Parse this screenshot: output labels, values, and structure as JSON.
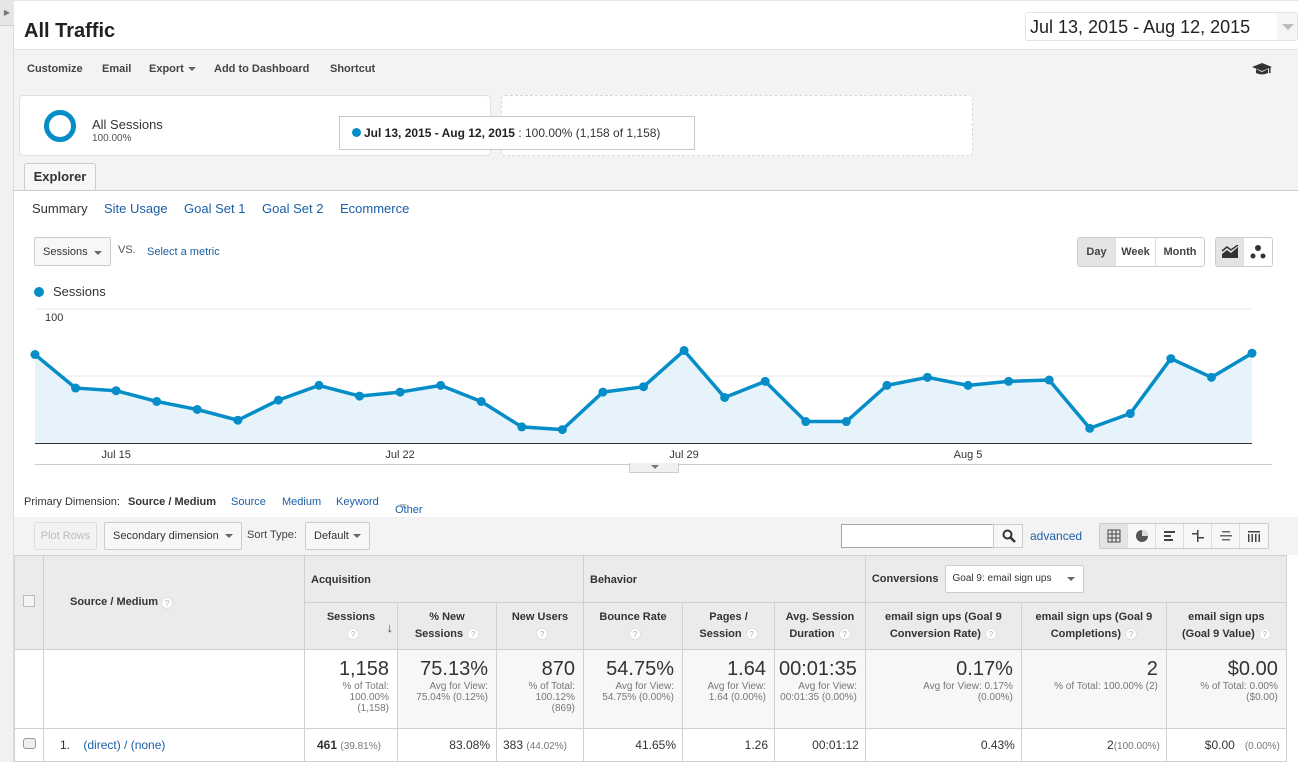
{
  "header": {
    "title": "All Traffic",
    "date_range": "Jul 13, 2015 - Aug 12, 2015"
  },
  "toolbar": {
    "customize": "Customize",
    "email": "Email",
    "export": "Export",
    "add_to_dashboard": "Add to Dashboard",
    "shortcut": "Shortcut",
    "help_icon": "graduation-cap-icon"
  },
  "segments": {
    "name": "All Sessions",
    "percent": "100.00%"
  },
  "tooltip": {
    "range": "Jul 13, 2015 - Aug 12, 2015",
    "value": " : 100.00% (1,158 of 1,158)"
  },
  "tabs": {
    "explorer": "Explorer",
    "subtabs": [
      "Summary",
      "Site Usage",
      "Goal Set 1",
      "Goal Set 2",
      "Ecommerce"
    ]
  },
  "chart_controls": {
    "metric": "Sessions",
    "vs": "VS.",
    "select_metric": "Select a metric",
    "granularity": [
      "Day",
      "Week",
      "Month"
    ],
    "granularity_selected": "Day"
  },
  "chart_data": {
    "type": "area",
    "title": "",
    "legend": [
      "Sessions"
    ],
    "legend_position": "top-left",
    "color": "#058dc7",
    "x": [
      "Jul 13",
      "Jul 14",
      "Jul 15",
      "Jul 16",
      "Jul 17",
      "Jul 18",
      "Jul 19",
      "Jul 20",
      "Jul 21",
      "Jul 22",
      "Jul 23",
      "Jul 24",
      "Jul 25",
      "Jul 26",
      "Jul 27",
      "Jul 28",
      "Jul 29",
      "Jul 30",
      "Jul 31",
      "Aug 1",
      "Aug 2",
      "Aug 3",
      "Aug 4",
      "Aug 5",
      "Aug 6",
      "Aug 7",
      "Aug 8",
      "Aug 9",
      "Aug 10",
      "Aug 11",
      "Aug 12"
    ],
    "series": [
      {
        "name": "Sessions",
        "values": [
          66,
          41,
          39,
          31,
          25,
          17,
          32,
          43,
          35,
          38,
          43,
          31,
          12,
          10,
          38,
          42,
          69,
          34,
          46,
          16,
          16,
          43,
          49,
          43,
          46,
          47,
          11,
          22,
          63,
          49,
          67
        ]
      }
    ],
    "xticks": [
      "Jul 15",
      "Jul 22",
      "Jul 29",
      "Aug 5"
    ],
    "yticks": [
      "100",
      "50"
    ],
    "ylim": [
      0,
      100
    ],
    "grid": true
  },
  "primary_dimension": {
    "label": "Primary Dimension:",
    "current": "Source / Medium",
    "options": [
      "Source",
      "Medium",
      "Keyword",
      "Other"
    ]
  },
  "table_tools": {
    "plot_rows": "Plot Rows",
    "secondary_dimension": "Secondary dimension",
    "sort_type_label": "Sort Type:",
    "sort_type": "Default",
    "search_placeholder": "",
    "advanced": "advanced"
  },
  "table": {
    "dim_header": "Source / Medium",
    "groups": {
      "acquisition": "Acquisition",
      "behavior": "Behavior",
      "conversions": "Conversions",
      "goal_select": "Goal 9: email sign ups"
    },
    "columns": [
      [
        "Sessions",
        ""
      ],
      [
        "% New",
        "Sessions"
      ],
      [
        "New Users",
        ""
      ],
      [
        "Bounce Rate",
        ""
      ],
      [
        "Pages /",
        "Session"
      ],
      [
        "Avg. Session",
        "Duration"
      ],
      [
        "email sign ups (Goal 9",
        "Conversion Rate)"
      ],
      [
        "email sign ups (Goal 9",
        "Completions)"
      ],
      [
        "email sign ups",
        "(Goal 9 Value)"
      ]
    ],
    "totals": [
      {
        "value": "1,158",
        "sub": [
          "% of Total:",
          "100.00%",
          "(1,158)"
        ]
      },
      {
        "value": "75.13%",
        "sub": [
          "Avg for View:",
          "75.04% (0.12%)"
        ]
      },
      {
        "value": "870",
        "sub": [
          "% of Total:",
          "100.12%",
          "(869)"
        ]
      },
      {
        "value": "54.75%",
        "sub": [
          "Avg for View:",
          "54.75% (0.00%)"
        ]
      },
      {
        "value": "1.64",
        "sub": [
          "Avg for View:",
          "1.64 (0.00%)"
        ]
      },
      {
        "value": "00:01:35",
        "sub": [
          "Avg for View:",
          "00:01:35 (0.00%)"
        ]
      },
      {
        "value": "0.17%",
        "sub": [
          "Avg for View: 0.17%",
          "(0.00%)"
        ]
      },
      {
        "value": "2",
        "sub": [
          "% of Total: 100.00% (2)"
        ]
      },
      {
        "value": "$0.00",
        "sub": [
          "% of Total: 0.00%",
          "($0.00)"
        ]
      }
    ],
    "rows": [
      {
        "index": "1.",
        "dimension": "(direct) / (none)",
        "sessions": "461",
        "sessions_pct": "(39.81%)",
        "pct_new": "83.08%",
        "new_users": "383",
        "new_users_pct": "(44.02%)",
        "bounce": "41.65%",
        "pages": "1.26",
        "duration": "00:01:12",
        "conv_rate": "0.43%",
        "completions": "2",
        "completions_pct": "(100.00%)",
        "value": "$0.00",
        "value_pct": "(0.00%)"
      }
    ]
  }
}
